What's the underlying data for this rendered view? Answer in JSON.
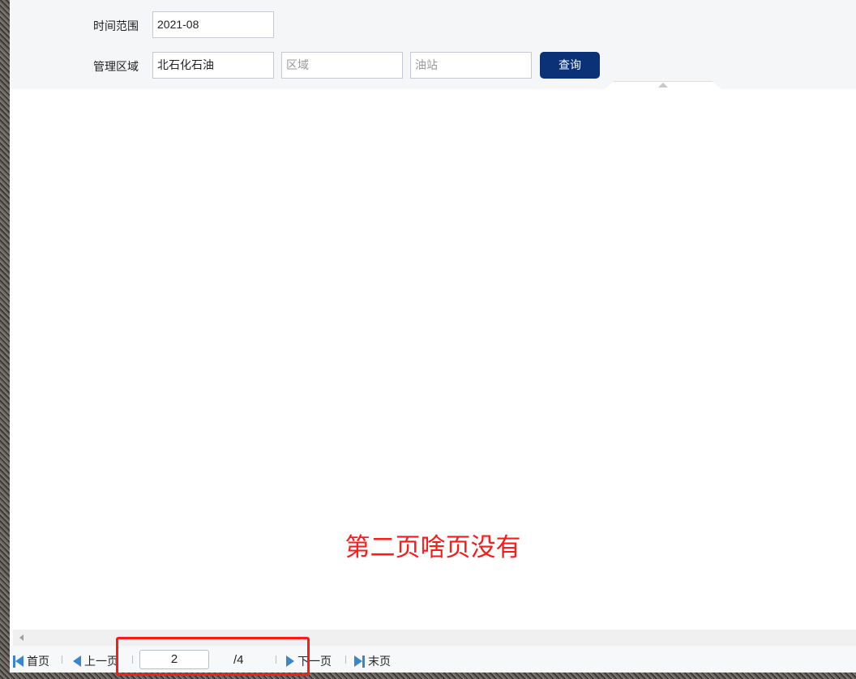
{
  "filters": {
    "time_label": "时间范围",
    "time_value": "2021-08",
    "region_label": "管理区域",
    "company_value": "北石化石油",
    "area_placeholder": "区域",
    "station_placeholder": "油站",
    "query_label": "查询"
  },
  "annotation": {
    "text": "第二页啥页没有"
  },
  "pager": {
    "first": "首页",
    "prev": "上一页",
    "current": "2",
    "total": "/4",
    "next": "下一页",
    "last": "末页"
  },
  "colors": {
    "primary": "#0b3277",
    "annotation": "#ff1a1a",
    "pager_icon": "#3a85d0"
  }
}
